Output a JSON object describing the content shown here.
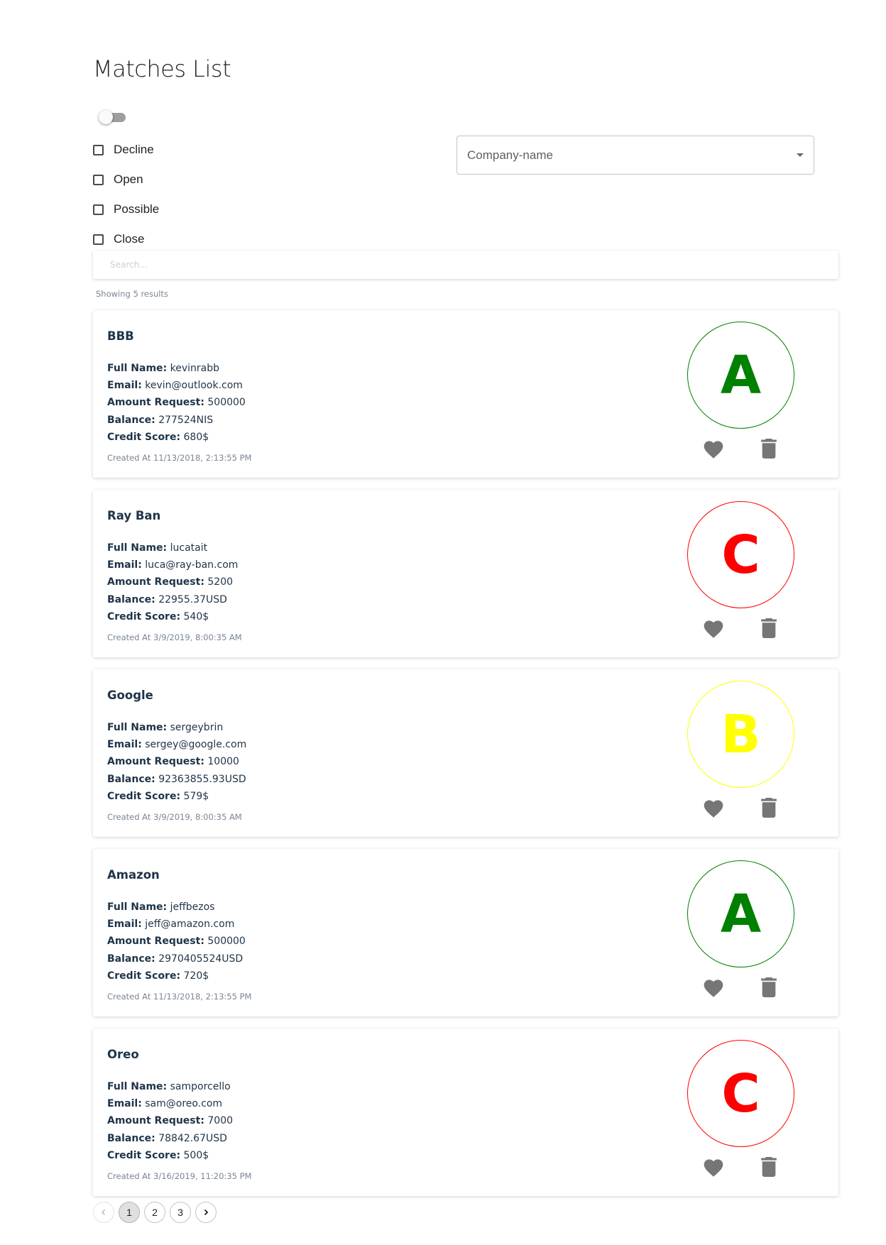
{
  "page": {
    "title": "Matches List"
  },
  "toggle": {
    "on": false
  },
  "filters": [
    {
      "label": "Decline",
      "checked": false
    },
    {
      "label": "Open",
      "checked": false
    },
    {
      "label": "Possible",
      "checked": false
    },
    {
      "label": "Close",
      "checked": false
    }
  ],
  "company_select": {
    "placeholder": "Company-name"
  },
  "search": {
    "placeholder": "Search..."
  },
  "results_text": "Showing 5 results",
  "labels": {
    "full_name": "Full Name:",
    "email": "Email:",
    "amount_request": "Amount Request:",
    "balance": "Balance:",
    "credit_score": "Credit Score:"
  },
  "grade_colors": {
    "A": "#008000",
    "B": "#ffff00",
    "C": "#ff0000"
  },
  "icon_color": "#767676",
  "cards": [
    {
      "company": "BBB",
      "full_name": "kevinrabb",
      "email": "kevin@outlook.com",
      "amount_request": "500000",
      "balance": "277524NIS",
      "credit_score": "680$",
      "created": "Created At 11/13/2018, 2:13:55 PM",
      "grade": "A"
    },
    {
      "company": "Ray Ban",
      "full_name": "lucatait",
      "email": "luca@ray-ban.com",
      "amount_request": "5200",
      "balance": "22955.37USD",
      "credit_score": "540$",
      "created": "Created At 3/9/2019, 8:00:35 AM",
      "grade": "C"
    },
    {
      "company": "Google",
      "full_name": "sergeybrin",
      "email": "sergey@google.com",
      "amount_request": "10000",
      "balance": "92363855.93USD",
      "credit_score": "579$",
      "created": "Created At 3/9/2019, 8:00:35 AM",
      "grade": "B"
    },
    {
      "company": "Amazon",
      "full_name": "jeffbezos",
      "email": "jeff@amazon.com",
      "amount_request": "500000",
      "balance": "2970405524USD",
      "credit_score": "720$",
      "created": "Created At 11/13/2018, 2:13:55 PM",
      "grade": "A"
    },
    {
      "company": "Oreo",
      "full_name": "samporcello",
      "email": "sam@oreo.com",
      "amount_request": "7000",
      "balance": "78842.67USD",
      "credit_score": "500$",
      "created": "Created At 3/16/2019, 11:20:35 PM",
      "grade": "C"
    }
  ],
  "pagination": {
    "pages": [
      "1",
      "2",
      "3"
    ],
    "current": "1"
  }
}
